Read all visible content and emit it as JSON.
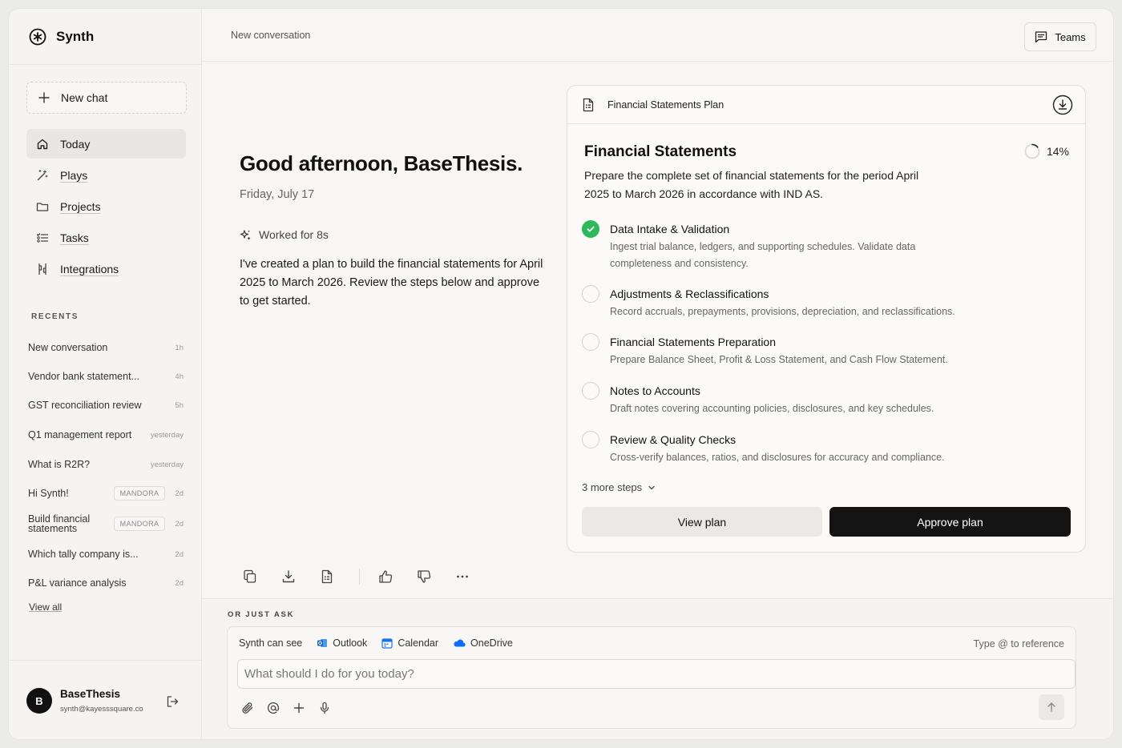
{
  "app": {
    "name": "Synth"
  },
  "sidebar": {
    "new_chat_label": "New chat",
    "nav": [
      {
        "label": "Today",
        "icon": "home-icon",
        "active": true
      },
      {
        "label": "Plays",
        "icon": "magic-wand-icon"
      },
      {
        "label": "Projects",
        "icon": "folder-icon"
      },
      {
        "label": "Tasks",
        "icon": "list-icon"
      },
      {
        "label": "Integrations",
        "icon": "plug-icon"
      }
    ],
    "recents_title": "RECENTS",
    "recents": [
      {
        "title": "New conversation",
        "time": "1h"
      },
      {
        "title": "Vendor bank statement...",
        "time": "4h"
      },
      {
        "title": "GST reconciliation review",
        "time": "5h"
      },
      {
        "title": "Q1 management report",
        "time": "yesterday"
      },
      {
        "title": "What is R2R?",
        "time": "yesterday"
      },
      {
        "title": "Hi Synth!",
        "tag": "MANDORA",
        "time": "2d"
      },
      {
        "title": "Build financial statements",
        "tag": "MANDORA",
        "time": "2d"
      },
      {
        "title": "Which tally company is...",
        "time": "2d"
      },
      {
        "title": "P&L variance analysis",
        "time": "2d"
      }
    ],
    "view_all": "View all",
    "user": {
      "initial": "B",
      "name": "BaseThesis",
      "email": "synth@kayesssquare.co"
    }
  },
  "topbar": {
    "title": "New conversation",
    "teams_label": "Teams"
  },
  "chat": {
    "greeting": "Good afternoon, BaseThesis.",
    "date": "Friday, July 17",
    "worked": "Worked for 8s",
    "message": "I've created a plan to build the financial statements for April 2025 to March 2026. Review the steps below and approve to get started."
  },
  "plan": {
    "header": "Financial Statements Plan",
    "title": "Financial Statements",
    "progress_label": "14%",
    "progress": 0.14,
    "description": "Prepare the complete set of financial statements for the period April 2025 to March 2026 in accordance with IND AS.",
    "steps": [
      {
        "title": "Data Intake & Validation",
        "desc": "Ingest trial balance, ledgers, and supporting schedules. Validate data completeness and consistency.",
        "done": true
      },
      {
        "title": "Adjustments & Reclassifications",
        "desc": "Record accruals, prepayments, provisions, depreciation, and reclassifications.",
        "done": false
      },
      {
        "title": "Financial Statements Preparation",
        "desc": "Prepare Balance Sheet, Profit & Loss Statement, and Cash Flow Statement.",
        "done": false
      },
      {
        "title": "Notes to Accounts",
        "desc": "Draft notes covering accounting policies, disclosures, and key schedules.",
        "done": false
      },
      {
        "title": "Review & Quality Checks",
        "desc": "Cross-verify balances, ratios, and disclosures for accuracy and compliance.",
        "done": false
      }
    ],
    "more_steps": "3 more steps",
    "view_label": "View plan",
    "approve_label": "Approve plan"
  },
  "composer": {
    "ask_label": "OR JUST ASK",
    "can_see": "Synth can see",
    "sources": [
      {
        "name": "Outlook",
        "color": "#0a64c8"
      },
      {
        "name": "Calendar",
        "color": "#1a73e8"
      },
      {
        "name": "OneDrive",
        "color": "#0d6efd"
      }
    ],
    "type_ref": "Type @ to reference",
    "placeholder": "What should I do for you today?"
  }
}
